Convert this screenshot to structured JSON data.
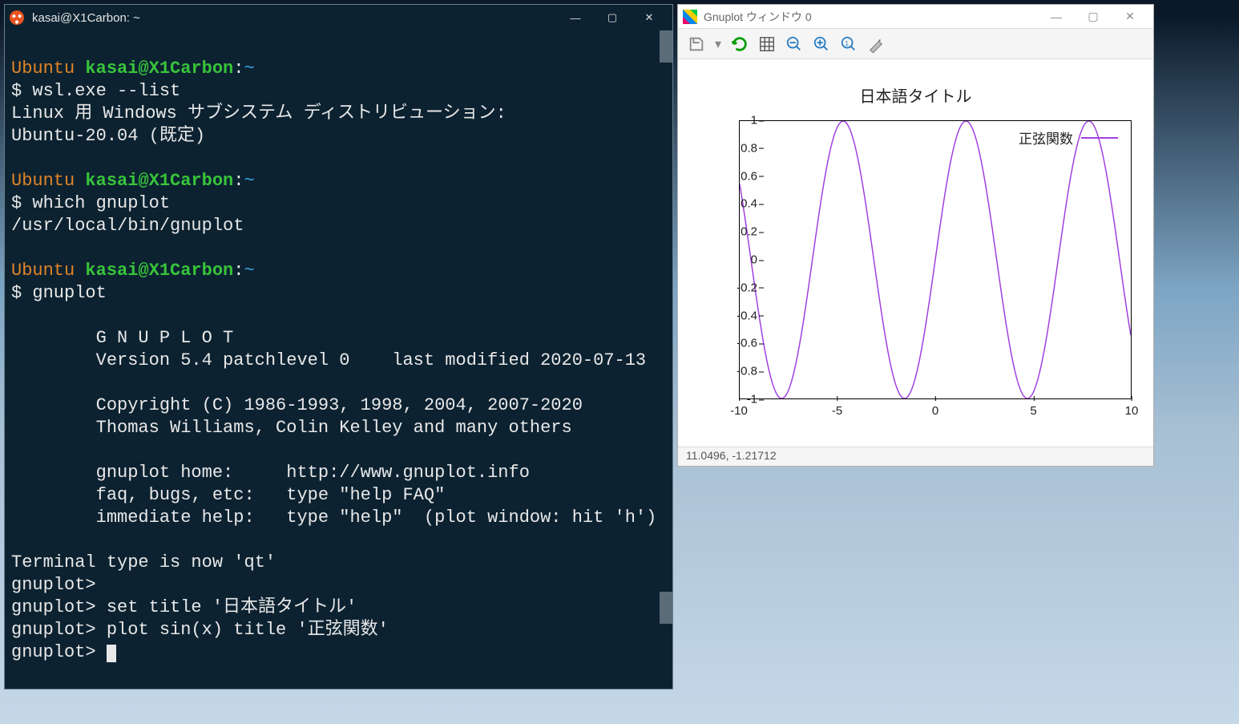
{
  "terminal": {
    "title": "kasai@X1Carbon: ~",
    "os_label": "Ubuntu",
    "user_host": "kasai@X1Carbon",
    "colon": ":",
    "cwd": "~",
    "cmd1": "$ wsl.exe --list",
    "wsl_header": "Linux 用 Windows サブシステム ディストリビューション:",
    "wsl_distro": "Ubuntu-20.04 (既定)",
    "cmd2": "$ which gnuplot",
    "which_out": "/usr/local/bin/gnuplot",
    "cmd3": "$ gnuplot",
    "banner1": "        G N U P L O T",
    "banner2": "        Version 5.4 patchlevel 0    last modified 2020-07-13",
    "banner3": "        Copyright (C) 1986-1993, 1998, 2004, 2007-2020",
    "banner4": "        Thomas Williams, Colin Kelley and many others",
    "banner5": "        gnuplot home:     http://www.gnuplot.info",
    "banner6": "        faq, bugs, etc:   type \"help FAQ\"",
    "banner7": "        immediate help:   type \"help\"  (plot window: hit 'h')",
    "termtype": "Terminal type is now 'qt'",
    "gp_prompt": "gnuplot>",
    "gp_cmd1": "gnuplot> set title '日本語タイトル'",
    "gp_cmd2": "gnuplot> plot sin(x) title '正弦関数'"
  },
  "plot_window": {
    "title": "Gnuplot ウィンドウ 0",
    "status": "11.0496, -1.21712",
    "toolbar": {
      "export": "export-icon",
      "reload": "reload-icon",
      "grid": "grid-icon",
      "zoom_out": "zoom-out-icon",
      "zoom_in": "zoom-in-icon",
      "zoom_reset": "zoom-reset-icon",
      "settings": "settings-icon"
    }
  },
  "chart_data": {
    "type": "line",
    "title": "日本語タイトル",
    "xlabel": "",
    "ylabel": "",
    "xlim": [
      -10,
      10
    ],
    "ylim": [
      -1,
      1
    ],
    "xticks": [
      -10,
      -5,
      0,
      5,
      10
    ],
    "yticks": [
      -1,
      -0.8,
      -0.6,
      -0.4,
      -0.2,
      0,
      0.2,
      0.4,
      0.6,
      0.8,
      1
    ],
    "series": [
      {
        "name": "正弦関数",
        "color": "#a040e0",
        "function": "sin(x)",
        "x": [
          -10,
          -9.5,
          -9,
          -8.5,
          -8,
          -7.5,
          -7,
          -6.5,
          -6,
          -5.5,
          -5,
          -4.5,
          -4,
          -3.5,
          -3,
          -2.5,
          -2,
          -1.5,
          -1,
          -0.5,
          0,
          0.5,
          1,
          1.5,
          2,
          2.5,
          3,
          3.5,
          4,
          4.5,
          5,
          5.5,
          6,
          6.5,
          7,
          7.5,
          8,
          8.5,
          9,
          9.5,
          10
        ],
        "y": [
          0.544,
          -0.075,
          -0.412,
          -0.798,
          -0.989,
          -0.938,
          -0.657,
          -0.215,
          0.279,
          0.706,
          0.959,
          0.978,
          0.757,
          0.351,
          -0.141,
          -0.599,
          -0.909,
          -0.997,
          -0.841,
          -0.479,
          0,
          0.479,
          0.841,
          0.997,
          0.909,
          0.599,
          0.141,
          -0.351,
          -0.757,
          -0.978,
          -0.959,
          -0.706,
          -0.279,
          0.215,
          0.657,
          0.938,
          0.989,
          0.798,
          0.412,
          0.075,
          -0.544
        ]
      }
    ],
    "legend_position": "top-right"
  }
}
